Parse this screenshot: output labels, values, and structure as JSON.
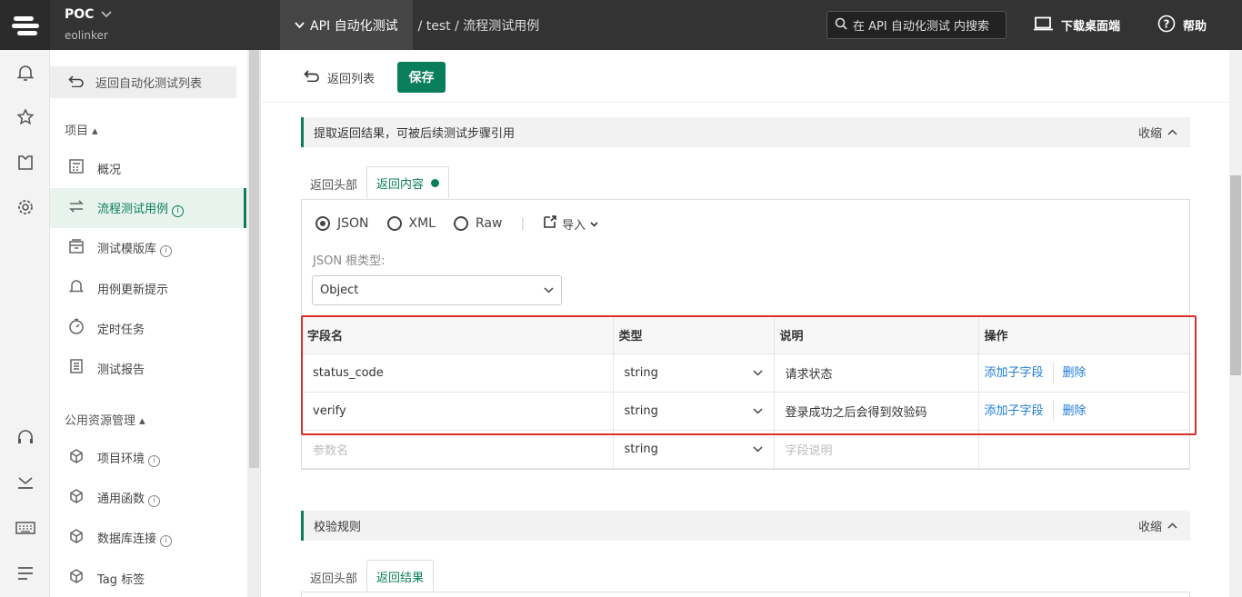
{
  "header": {
    "project_name": "POC",
    "project_sub": "eolinker",
    "breadcrumb_current": "API 自动化测试",
    "breadcrumb_rest": "/ test / 流程测试用例",
    "search_placeholder": "在 API 自动化测试 内搜索",
    "download_label": "下载桌面端",
    "help_label": "帮助"
  },
  "sidebar": {
    "back_label": "返回自动化测试列表",
    "section_project": "项目",
    "items": [
      {
        "label": "概况"
      },
      {
        "label": "流程测试用例"
      },
      {
        "label": "测试模版库"
      },
      {
        "label": "用例更新提示"
      },
      {
        "label": "定时任务"
      },
      {
        "label": "测试报告"
      }
    ],
    "section_public": "公用资源管理",
    "public_items": [
      {
        "label": "项目环境"
      },
      {
        "label": "通用函数"
      },
      {
        "label": "数据库连接"
      },
      {
        "label": "Tag 标签"
      }
    ]
  },
  "toolbar": {
    "back_label": "返回列表",
    "save_label": "保存"
  },
  "extract_section": {
    "title": "提取返回结果，可被后续测试步骤引用",
    "collapse_label": "收缩",
    "tabs": [
      "返回头部",
      "返回内容"
    ],
    "formats": [
      "JSON",
      "XML",
      "Raw"
    ],
    "selected_format": "JSON",
    "import_label": "导入",
    "root_type_label": "JSON 根类型:",
    "root_type_value": "Object",
    "columns": [
      "字段名",
      "类型",
      "说明",
      "操作"
    ],
    "rows": [
      {
        "name": "status_code",
        "type": "string",
        "desc": "请求状态",
        "add": "添加子字段",
        "del": "删除"
      },
      {
        "name": "verify",
        "type": "string",
        "desc": "登录成功之后会得到效验码",
        "add": "添加子字段",
        "del": "删除"
      }
    ],
    "new_row": {
      "name_placeholder": "参数名",
      "type": "string",
      "desc_placeholder": "字段说明"
    }
  },
  "verify_section": {
    "title": "校验规则",
    "collapse_label": "收缩",
    "tabs": [
      "返回头部",
      "返回结果"
    ]
  },
  "colors": {
    "accent": "#0a7e5a",
    "highlight": "#d9302a",
    "link": "#1e7bd6"
  }
}
